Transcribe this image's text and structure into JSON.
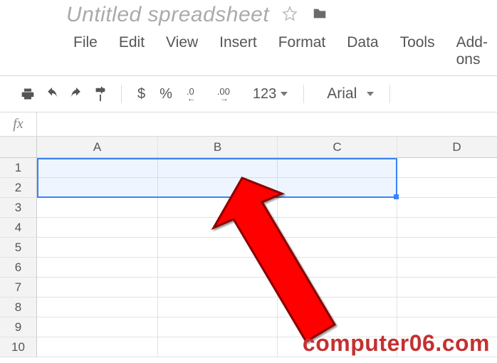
{
  "header": {
    "title": "Untitled spreadsheet"
  },
  "menu": {
    "file": "File",
    "edit": "Edit",
    "view": "View",
    "insert": "Insert",
    "format": "Format",
    "data": "Data",
    "tools": "Tools",
    "addons": "Add-ons"
  },
  "toolbar": {
    "currency": "$",
    "percent": "%",
    "dec_less": ".0",
    "dec_more": ".00",
    "more_formats": "123",
    "font": "Arial"
  },
  "formula": {
    "label": "fx",
    "value": ""
  },
  "grid": {
    "columns": [
      "A",
      "B",
      "C",
      "D"
    ],
    "rows": [
      "1",
      "2",
      "3",
      "4",
      "5",
      "6",
      "7",
      "8",
      "9",
      "10"
    ],
    "selection": {
      "from": "A1",
      "to": "C2"
    }
  },
  "watermark": "computer06.com"
}
